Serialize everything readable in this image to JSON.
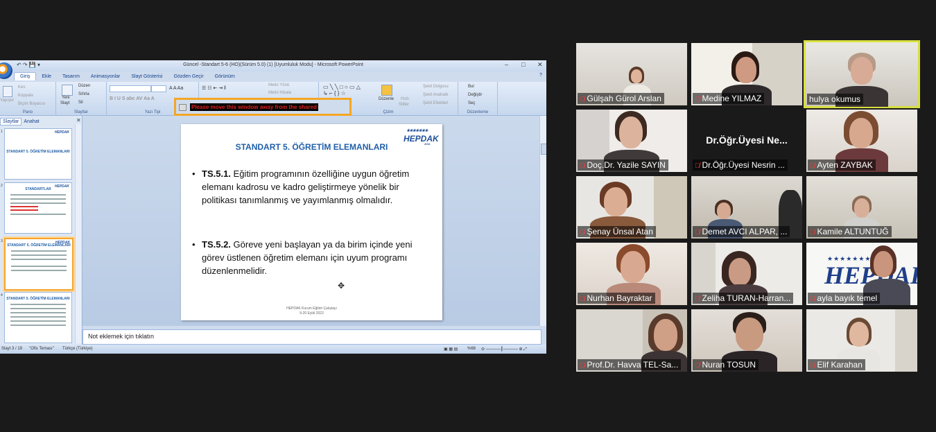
{
  "ppt": {
    "window_title": "Güncel -Standart 5-6 (HO)(Sürüm 5.0) (1) [Uyumluluk Modu] - Microsoft PowerPoint",
    "tabs": [
      "Giriş",
      "Ekle",
      "Tasarım",
      "Animasyonlar",
      "Slayt Gösterisi",
      "Gözden Geçir",
      "Görünüm"
    ],
    "ribbon": {
      "clipboard": {
        "cut": "Kes",
        "copy": "Kopyala",
        "format_painter": "Biçim Boyacısı",
        "paste": "Yapıştır",
        "label": "Pano"
      },
      "slides": {
        "new_slide_1": "Yeni",
        "new_slide_2": "Slayt",
        "layout": "Düzen",
        "reset": "Sıfırla",
        "delete": "Sil",
        "label": "Slaytlar"
      },
      "font": {
        "label": "Yazı Tipi"
      },
      "paragraph": {
        "text_direction": "Metin Yönü",
        "align_text": "Metni Hizala"
      },
      "drawing": {
        "arrange": "Düzenle",
        "quick_styles_1": "Hızlı",
        "quick_styles_2": "Stiller",
        "shape_fill": "Şekil Dolgusu",
        "shape_outline": "Şekil Anahattı",
        "shape_effects": "Şekil Efektleri",
        "label": "Çizim"
      },
      "editing": {
        "find": "Bul",
        "replace": "Değiştir",
        "select": "Seç",
        "label": "Düzenleme"
      }
    },
    "share_warning": "Please move this window away from the shared",
    "panel_tabs": [
      "Slaytlar",
      "Anahat"
    ],
    "thumbnails": [
      {
        "num": "1",
        "title": "STANDART 5. ÖĞRETİM ELEMANLARI",
        "logo": "HEPDAK"
      },
      {
        "num": "2",
        "title": "STANDARTLAR",
        "logo": "HEPDAK"
      },
      {
        "num": "3",
        "title": "STANDART 5. ÖĞRETİM ELEMANLARI",
        "logo": "HEPDAK"
      },
      {
        "num": "4",
        "title": "STANDART 5. ÖĞRETİM ELEMANLARI",
        "logo": "HEPDAK"
      }
    ],
    "slide": {
      "title": "STANDART 5.  ÖĞRETİM ELEMANLARI",
      "logo": "HEPDAK",
      "logo_year": "2011",
      "bullets": [
        {
          "code": "TS.5.1.",
          "text": " Eğitim programının özelliğine uygun öğretim elemanı kadrosu ve kadro geliştirmeye yönelik bir politikası tanımlanmış ve yayımlanmış olmalıdır."
        },
        {
          "code": "TS.5.2.",
          "text": " Göreve yeni başlayan ya da birim içinde yeni görev üstlenen öğretim elemanı için uyum programı düzenlenmelidir."
        }
      ],
      "footer_line1": "HEPDAK Kurum Eğitim Çalıştayı",
      "footer_line2": "9-20 Eylül 2022"
    },
    "notes_placeholder": "Not eklemek için tıklatın",
    "status": {
      "slide": "Slayt 3 / 19",
      "theme": "\"Ofis Teması\"",
      "language": "Türkçe (Türkiye)",
      "zoom": "%68"
    }
  },
  "participants": [
    {
      "name": "Gülşah Gürol Arslan",
      "muted": true
    },
    {
      "name": "Medine YILMAZ",
      "muted": true
    },
    {
      "name": "hulya okumus",
      "muted": false,
      "active_speaker": true
    },
    {
      "name": "Doç.Dr. Yazile SAYIN",
      "muted": true
    },
    {
      "name": "Dr.Öğr.Üyesi Nesrin ...",
      "muted": true,
      "display": "Dr.Öğr.Üyesi  Ne..."
    },
    {
      "name": "Ayten ZAYBAK",
      "muted": true
    },
    {
      "name": "Şenay Ünsal Atan",
      "muted": true
    },
    {
      "name": "Demet AVCI ALPAR, ...",
      "muted": true
    },
    {
      "name": "Kamile ALTUNTUĞ",
      "muted": true
    },
    {
      "name": "Nurhan Bayraktar",
      "muted": true
    },
    {
      "name": "Zeliha TURAN-Harran...",
      "muted": true
    },
    {
      "name": "ayla bayık temel",
      "muted": true,
      "backdrop_logo": "HEPDAK"
    },
    {
      "name": "Prof.Dr. Havva TEL-Sa...",
      "muted": true
    },
    {
      "name": "Nuran TOSUN",
      "muted": true
    },
    {
      "name": "Elif Karahan",
      "muted": true
    }
  ],
  "colors": {
    "active_speaker_border": "#d8e040",
    "mute_icon": "#ff3b3b",
    "warning_border": "#f5a623",
    "slide_title": "#1f5fa8"
  }
}
